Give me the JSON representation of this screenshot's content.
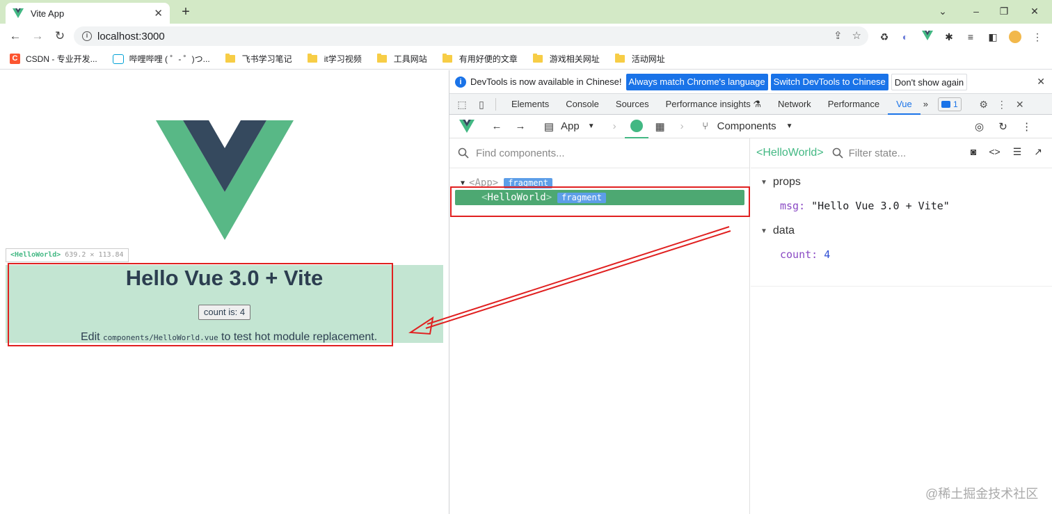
{
  "browser": {
    "tab_title": "Vite App",
    "tab_close": "✕",
    "new_tab": "+",
    "url": "localhost:3000"
  },
  "bookmarks": [
    {
      "label": "CSDN - 专业开发...",
      "icon": "csdn-icon"
    },
    {
      "label": "哔哩哔哩 ( ゜- ゜)つ...",
      "icon": "bilibili-icon"
    },
    {
      "label": "飞书学习笔记",
      "icon": "folder-icon"
    },
    {
      "label": "it学习视频",
      "icon": "folder-icon"
    },
    {
      "label": "工具网站",
      "icon": "folder-icon"
    },
    {
      "label": "有用好便的文章",
      "icon": "folder-icon"
    },
    {
      "label": "游戏相关网址",
      "icon": "folder-icon"
    },
    {
      "label": "活动网址",
      "icon": "folder-icon"
    }
  ],
  "page": {
    "overlay_tag_name": "<HelloWorld>",
    "overlay_tag_size": "639.2 ✕ 113.84",
    "title": "Hello Vue 3.0 + Vite",
    "button_label": "count is: 4",
    "edit_prefix": "Edit ",
    "edit_code": "components/HelloWorld.vue",
    "edit_suffix": " to test hot module replacement."
  },
  "devtools": {
    "info_message": "DevTools is now available in Chinese!",
    "btn_always_match": "Always match Chrome's language",
    "btn_switch": "Switch DevTools to Chinese",
    "btn_dont_show": "Don't show again",
    "tabs": [
      "Elements",
      "Console",
      "Sources",
      "Performance insights ⚗",
      "Network",
      "Performance",
      "Vue"
    ],
    "active_tab": "Vue",
    "more_tabs": "»",
    "issues_count": "1"
  },
  "vue_devtools": {
    "app_select": "App",
    "view_select": "Components",
    "search_placeholder": "Find components...",
    "tree": {
      "root_name": "<App>",
      "root_badge": "fragment",
      "child_open": "<",
      "child_name": "HelloWorld",
      "child_close": ">",
      "child_badge": "fragment"
    },
    "inspector": {
      "component_name": "<HelloWorld>",
      "filter_placeholder": "Filter state...",
      "sections": [
        {
          "title": "props",
          "key": "msg",
          "value": "\"Hello Vue 3.0 + Vite\""
        },
        {
          "title": "data",
          "key": "count",
          "value": "4"
        }
      ]
    }
  },
  "watermark": "@稀土掘金技术社区",
  "colors": {
    "vue_green": "#42b883",
    "vue_dark": "#35495e",
    "highlight_overlay": "#c3e5d2",
    "selected_node": "#4da872",
    "annotation_red": "#e02020",
    "chrome_tab_strip": "#d3e9c6",
    "devtools_blue": "#1a73e8"
  }
}
